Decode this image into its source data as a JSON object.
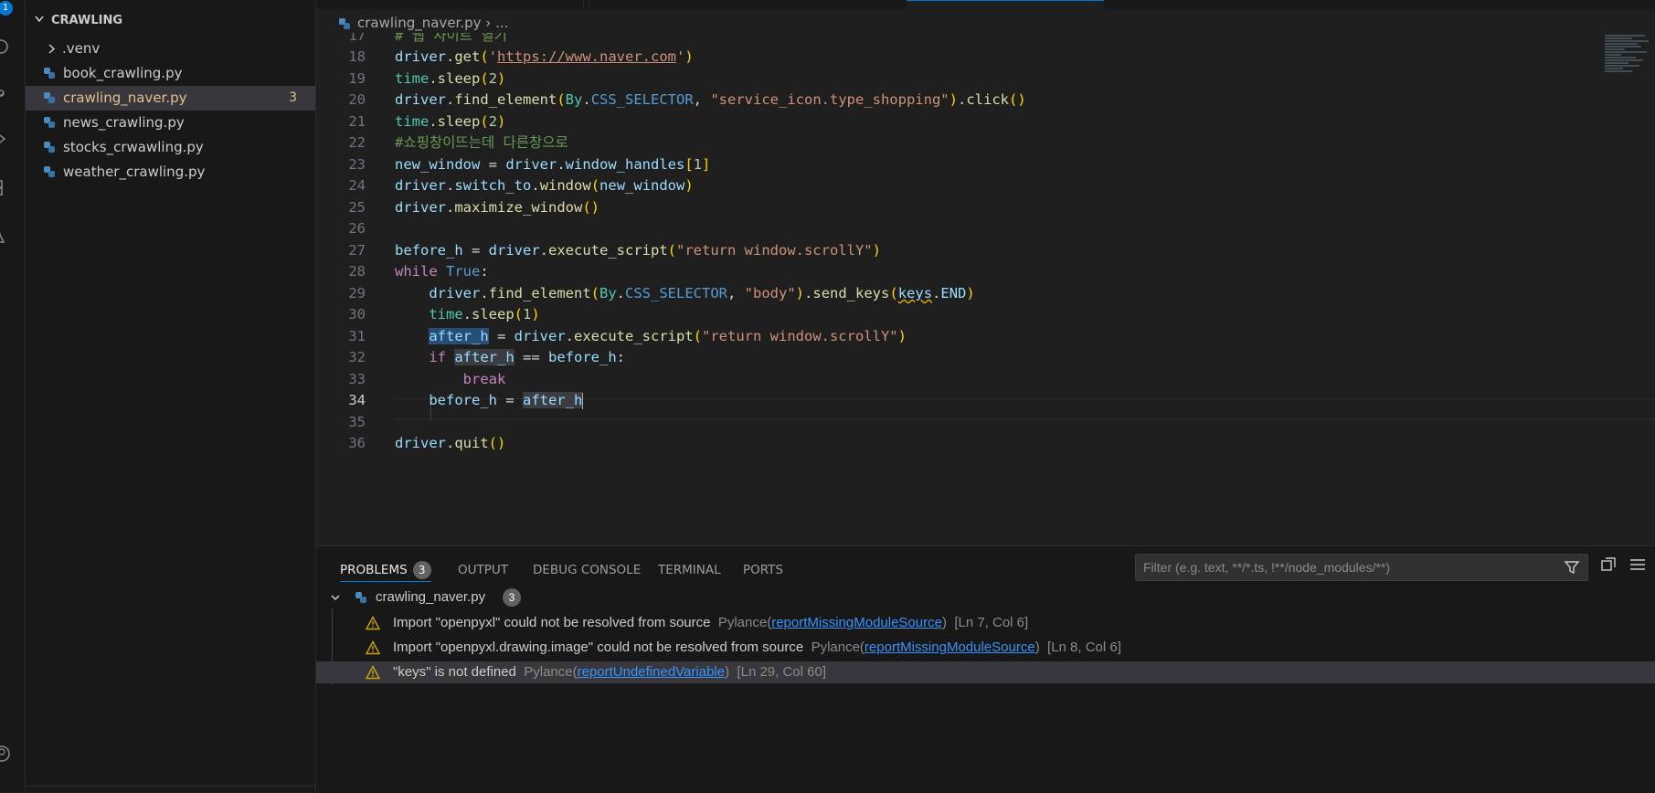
{
  "activity_bar": {
    "badge": "1"
  },
  "sidebar": {
    "title": "CRAWLING",
    "items": [
      {
        "label": ".venv",
        "kind": "folder"
      },
      {
        "label": "book_crawling.py",
        "kind": "python"
      },
      {
        "label": "crawling_naver.py",
        "kind": "python",
        "count": "3",
        "active": true
      },
      {
        "label": "news_crawling.py",
        "kind": "python"
      },
      {
        "label": "stocks_crwawling.py",
        "kind": "python"
      },
      {
        "label": "weather_crawling.py",
        "kind": "python"
      }
    ]
  },
  "editor": {
    "breadcrumb_file": "crawling_naver.py",
    "breadcrumb_sep": "›",
    "breadcrumb_more": "...",
    "line_numbers": [
      "17",
      "18",
      "19",
      "20",
      "21",
      "22",
      "23",
      "24",
      "25",
      "26",
      "27",
      "28",
      "29",
      "30",
      "31",
      "32",
      "33",
      "34",
      "35",
      "36"
    ],
    "current_line": "34",
    "code": {
      "l17": "# 웹 사이트 열기",
      "l18_url": "https://www.naver.com",
      "l20_selector": "\"service_icon.type_shopping\"",
      "l22": "#쇼핑창이뜨는데 다른창으로",
      "l27_str": "\"return window.scrollY\"",
      "l29_body": "\"body\"",
      "l31_str": "\"return window.scrollY\""
    }
  },
  "panel": {
    "tabs": [
      {
        "label": "PROBLEMS",
        "badge": "3",
        "active": true
      },
      {
        "label": "OUTPUT"
      },
      {
        "label": "DEBUG CONSOLE"
      },
      {
        "label": "TERMINAL"
      },
      {
        "label": "PORTS"
      }
    ],
    "filter_placeholder": "Filter (e.g. text, **/*.ts, !**/node_modules/**)",
    "group": {
      "file": "crawling_naver.py",
      "count": "3"
    },
    "problems": [
      {
        "message": "Import \"openpyxl\" could not be resolved from source",
        "source": "Pylance(",
        "code": "reportMissingModuleSource",
        "close": ")",
        "position": "[Ln 7, Col 6]"
      },
      {
        "message": "Import \"openpyxl.drawing.image\" could not be resolved from source",
        "source": "Pylance(",
        "code": "reportMissingModuleSource",
        "close": ")",
        "position": "[Ln 8, Col 6]"
      },
      {
        "message": "\"keys\" is not defined",
        "source": "Pylance(",
        "code": "reportUndefinedVariable",
        "close": ")",
        "position": "[Ln 29, Col 60]",
        "selected": true
      }
    ]
  },
  "colors": {
    "accent": "#0078d4",
    "warning": "#cca700",
    "modified": "#e2c08d"
  }
}
